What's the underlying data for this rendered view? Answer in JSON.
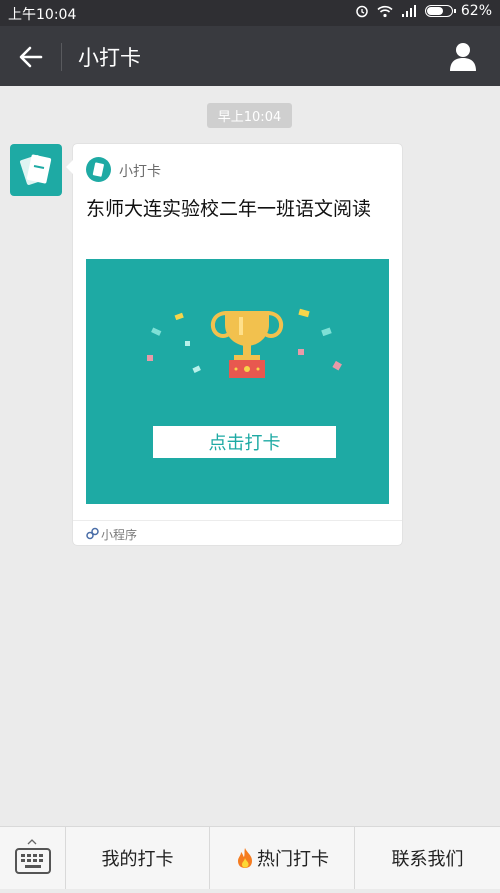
{
  "status_bar": {
    "time": "上午10:04",
    "battery_percent": "62%",
    "battery_level": 0.62,
    "icons": [
      "alarm-icon",
      "wifi-icon",
      "signal-icon",
      "battery-icon"
    ]
  },
  "nav": {
    "title": "小打卡",
    "icons": [
      "back-arrow-icon",
      "user-profile-icon"
    ]
  },
  "chat": {
    "timestamp": "早上10:04",
    "message": {
      "app_name": "小打卡",
      "title": "东师大连实验校二年一班语文阅读",
      "button_label": "点击打卡",
      "footer_label": "小程序",
      "icons": [
        "app-logo-icon",
        "trophy-icon",
        "mini-program-icon"
      ]
    }
  },
  "bottom_menu": {
    "items": [
      {
        "label": "我的打卡"
      },
      {
        "label": "热门打卡",
        "icon": "fire-icon"
      },
      {
        "label": "联系我们"
      }
    ],
    "keyboard_icon": "keyboard-icon"
  },
  "colors": {
    "brand": "#1eaaa4",
    "nav_bg": "#393a3f",
    "status_bg": "#2f2f33",
    "chat_bg": "#ebebeb"
  }
}
